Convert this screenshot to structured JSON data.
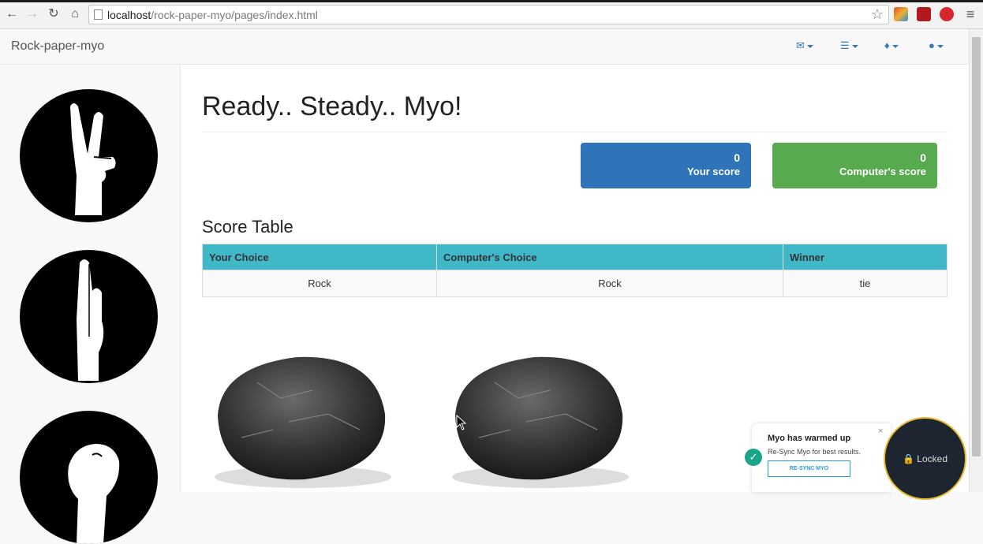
{
  "browser": {
    "url_host": "localhost",
    "url_path": "/rock-paper-myo/pages/index.html"
  },
  "navbar": {
    "brand": "Rock-paper-myo",
    "icons": [
      "envelope-icon",
      "tasks-icon",
      "bell-icon",
      "user-icon"
    ]
  },
  "sidebar": {
    "gestures": [
      "scissors-gesture",
      "paper-gesture",
      "rock-gesture"
    ]
  },
  "main": {
    "title": "Ready.. Steady.. Myo!",
    "your_score": {
      "value": "0",
      "label": "Your score",
      "color": "#337ab7"
    },
    "computer_score": {
      "value": "0",
      "label": "Computer's score",
      "color": "#5cb85c"
    },
    "score_table": {
      "title": "Score Table",
      "headers": [
        "Your Choice",
        "Computer's Choice",
        "Winner"
      ],
      "rows": [
        [
          "Rock",
          "Rock",
          "tie"
        ]
      ]
    },
    "images": [
      "rock-image-player",
      "rock-image-computer"
    ]
  },
  "myo_toast": {
    "title": "Myo has warmed up",
    "message": "Re-Sync Myo for best results.",
    "button": "RE-SYNC MYO",
    "close": "×",
    "status": "Locked"
  }
}
